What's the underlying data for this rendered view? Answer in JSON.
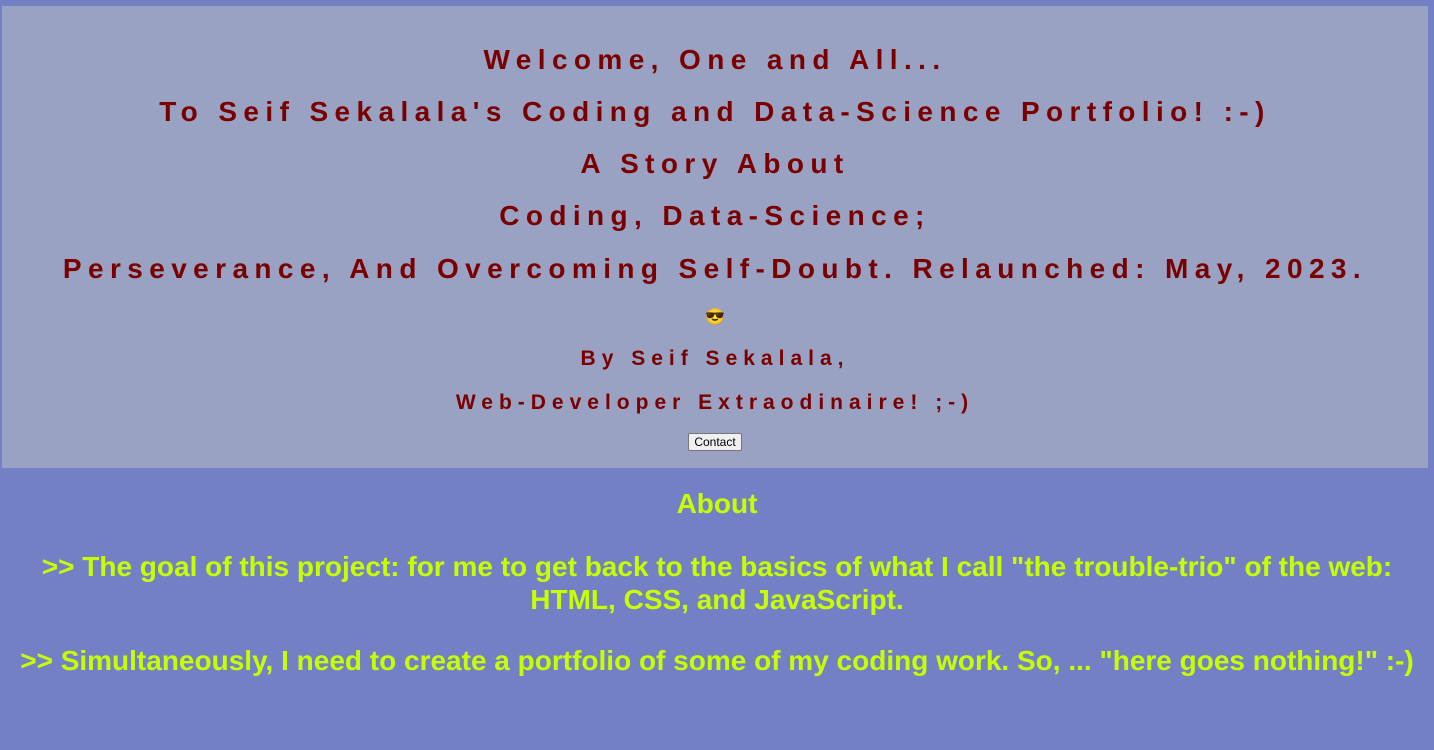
{
  "header": {
    "line1": "Welcome, One and All...",
    "line2": "To Seif Sekalala's Coding and Data-Science Portfolio! :-)",
    "line3": "A Story About",
    "line4": "Coding, Data-Science;",
    "line5": "Perseverance, And Overcoming Self-Doubt. Relaunched: May, 2023.",
    "emoji": "😎",
    "byline1": "By Seif Sekalala,",
    "byline2": "Web-Developer Extraodinaire! ;-)",
    "contact_label": "Contact"
  },
  "about": {
    "title": "About",
    "paragraph1": ">> The goal of this project: for me to get back to the basics of what I call \"the trouble-trio\" of the web: HTML, CSS, and JavaScript.",
    "paragraph2": ">> Simultaneously, I need to create a portfolio of some of my coding work. So, ... \"here goes nothing!\" :-)"
  },
  "colors": {
    "page_background": "#7380c6",
    "hero_background": "#9aa2c4",
    "heading_text": "#7a0000",
    "about_text": "#c8ff00"
  }
}
